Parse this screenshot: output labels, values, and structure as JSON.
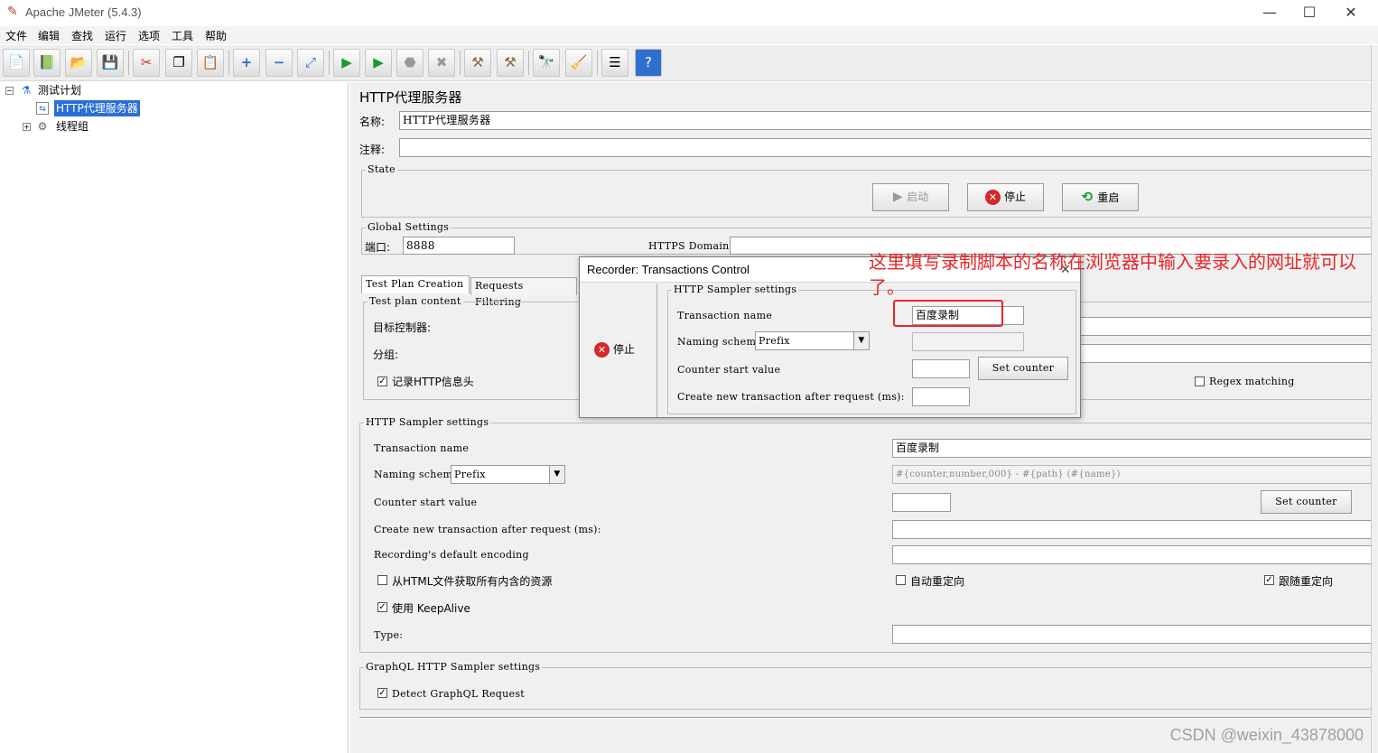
{
  "window": {
    "title": "Apache JMeter (5.4.3)",
    "minimize_glyph": "—",
    "maximize_glyph": "☐",
    "close_glyph": "✕"
  },
  "menu": [
    "文件",
    "编辑",
    "查找",
    "运行",
    "选项",
    "工具",
    "帮助"
  ],
  "toolbar_icons": [
    "new-icon",
    "templates-icon",
    "open-icon",
    "save-icon",
    "cut-icon",
    "copy-icon",
    "paste-icon",
    "expand-icon",
    "collapse-icon",
    "toggle-icon",
    "start-icon",
    "start-no-pause-icon",
    "stop-icon",
    "shutdown-icon",
    "clear-icon",
    "clear-all-icon",
    "search-icon",
    "reset-search-icon",
    "function-helper-icon",
    "help-icon"
  ],
  "tree": {
    "root": "测试计划",
    "proxy": "HTTP代理服务器",
    "thread_group": "线程组"
  },
  "panel": {
    "title": "HTTP代理服务器",
    "name_label": "名称:",
    "name_value": "HTTP代理服务器",
    "comment_label": "注释:",
    "comment_value": "",
    "state_group": "State",
    "start_btn": "启动",
    "stop_btn": "停止",
    "restart_btn": "重启",
    "global_group": "Global Settings",
    "port_label": "端口:",
    "port_value": "8888",
    "https_label": "HTTPS Domains:",
    "tabs": [
      "Test Plan Creation",
      "Requests Filtering"
    ],
    "test_plan_group": "Test plan content",
    "target_label": "目标控制器:",
    "grouping_label": "分组:",
    "record_headers_label": "记录HTTP信息头",
    "record_headers_checked": true,
    "regex_label": "Regex matching",
    "regex_checked": false,
    "sampler_group": "HTTP Sampler settings",
    "transaction_name_label": "Transaction name",
    "transaction_name_value": "百度录制",
    "naming_scheme_label": "Naming scheme",
    "naming_scheme_value": "Prefix",
    "naming_format": "#{counter,number,000} - #{path} (#{name})",
    "counter_start_label": "Counter start value",
    "set_counter_btn": "Set counter",
    "create_new_label": "Create new transaction after request (ms):",
    "encoding_label": "Recording's default encoding",
    "retrieve_resources_label": "从HTML文件获取所有内含的资源",
    "retrieve_resources_checked": false,
    "auto_redirect_label": "自动重定向",
    "auto_redirect_checked": false,
    "follow_redirect_label": "跟随重定向",
    "follow_redirect_checked": true,
    "keepalive_label": "使用 KeepAlive",
    "keepalive_checked": true,
    "type_label": "Type:",
    "graphql_group": "GraphQL HTTP Sampler settings",
    "graphql_label": "Detect GraphQL Request",
    "graphql_checked": true
  },
  "dialog": {
    "title": "Recorder: Transactions Control",
    "stop_btn": "停止",
    "group": "HTTP Sampler settings",
    "transaction_name_label": "Transaction name",
    "transaction_name_value": "百度录制",
    "naming_scheme_label": "Naming scheme",
    "naming_scheme_value": "Prefix",
    "counter_start_label": "Counter start value",
    "set_counter_btn": "Set counter",
    "create_new_label": "Create new transaction after request (ms):"
  },
  "annotation": "这里填写录制脚本的名称在浏览器中输入要录入的网址就可以了。",
  "watermark": "CSDN @weixin_43878000",
  "colors": {
    "selection": "#2a6fd6",
    "annotation_red": "#e8262a",
    "stop_red": "#d62828",
    "start_green": "#1a9a2a"
  }
}
